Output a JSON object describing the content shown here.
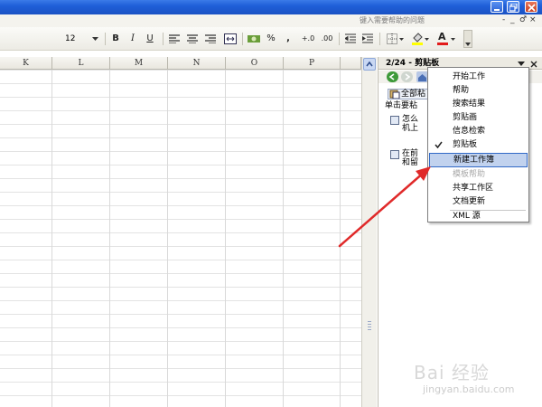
{
  "window": {
    "help_placeholder": "键入需要帮助的问题",
    "menu_controls": [
      "-",
      "_",
      "♂",
      "×"
    ]
  },
  "toolbar": {
    "font_size": "12",
    "bold": "B",
    "italic": "I",
    "underline": "U",
    "percent": "%",
    "comma": ",",
    "dec_inc": "+.0",
    "dec_dec": ".00",
    "font_color_letter": "A"
  },
  "columns": [
    "K",
    "L",
    "M",
    "N",
    "O",
    "P"
  ],
  "task_pane": {
    "title": "2/24 - 剪贴板",
    "paste_all_label": "全部粘",
    "clip_info": "单击要粘",
    "clip_items": [
      {
        "text": "怎么\n机上"
      },
      {
        "text": "在前\n和留"
      }
    ]
  },
  "dropdown": {
    "items": [
      {
        "label": "开始工作",
        "state": "normal"
      },
      {
        "label": "帮助",
        "state": "normal"
      },
      {
        "label": "搜索结果",
        "state": "normal"
      },
      {
        "label": "剪贴画",
        "state": "normal"
      },
      {
        "label": "信息检索",
        "state": "normal"
      },
      {
        "label": "剪贴板",
        "state": "checked"
      },
      {
        "label": "新建工作簿",
        "state": "selected"
      },
      {
        "label": "模板帮助",
        "state": "disabled"
      },
      {
        "label": "共享工作区",
        "state": "normal"
      },
      {
        "label": "文档更新",
        "state": "normal"
      },
      {
        "label": "XML 源",
        "state": "normal"
      }
    ]
  },
  "watermark": {
    "brand": "Bai 经验",
    "url": "jingyan.baidu.com"
  },
  "colors": {
    "titlebar": "#1f5fd8",
    "selection": "#c1d2ee",
    "arrow": "#e02a2a"
  }
}
